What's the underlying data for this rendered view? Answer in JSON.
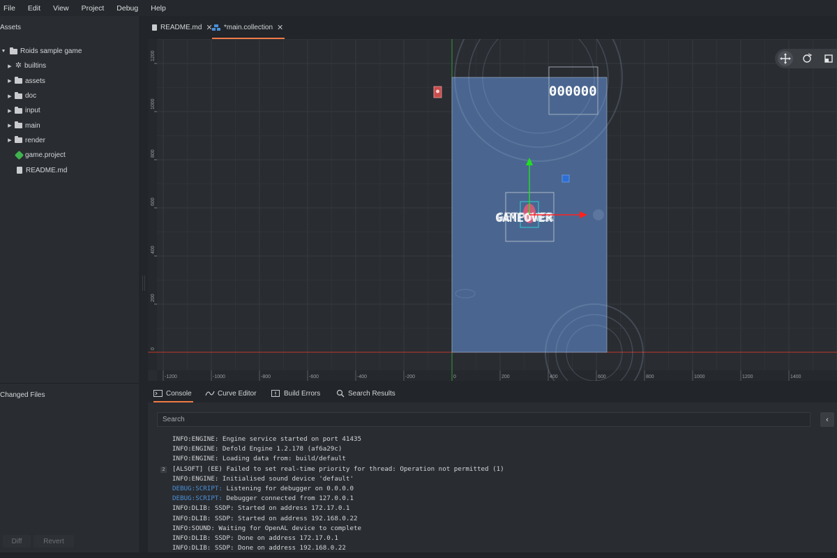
{
  "menu": [
    "File",
    "Edit",
    "View",
    "Project",
    "Debug",
    "Help"
  ],
  "assets_panel": {
    "title": "Assets",
    "tree": [
      {
        "label": "Roids sample game",
        "type": "folder",
        "depth": 0,
        "expanded": true
      },
      {
        "label": "builtins",
        "type": "cog",
        "depth": 1
      },
      {
        "label": "assets",
        "type": "folder",
        "depth": 1
      },
      {
        "label": "doc",
        "type": "folder",
        "depth": 1
      },
      {
        "label": "input",
        "type": "folder",
        "depth": 1
      },
      {
        "label": "main",
        "type": "folder",
        "depth": 1
      },
      {
        "label": "render",
        "type": "folder",
        "depth": 1
      },
      {
        "label": "game.project",
        "type": "project",
        "depth": 1
      },
      {
        "label": "README.md",
        "type": "doc",
        "depth": 1
      }
    ]
  },
  "changed_files": {
    "title": "Changed Files",
    "diff_label": "Diff",
    "revert_label": "Revert"
  },
  "editor_tabs": [
    {
      "label": "README.md",
      "icon": "doc-icon",
      "active": false
    },
    {
      "label": "*main.collection",
      "icon": "collection-icon",
      "active": true
    }
  ],
  "scene": {
    "y_ticks": [
      "1200",
      "1000",
      "800",
      "600",
      "400",
      "200",
      "0"
    ],
    "x_ticks": [
      "-1200",
      "-1000",
      "-800",
      "-600",
      "-400",
      "-200",
      "0",
      "200",
      "400",
      "600",
      "800",
      "1000",
      "1200",
      "1400"
    ],
    "score_text": "000000",
    "overlay_text": "GAMEOVER",
    "overlay_text_2": "GETPOWER",
    "colors": {
      "grid_bg": "#292c31",
      "game_area": "#4a6690",
      "x_axis": "#c0392b",
      "y_axis": "#3a9b3a",
      "gizmo_x": "#ff2020",
      "gizmo_y": "#20e020"
    },
    "toolbar_icons": [
      "move-tool-icon",
      "rotate-tool-icon",
      "scale-tool-icon"
    ]
  },
  "console_tabs": [
    {
      "label": "Console",
      "icon": "terminal-icon",
      "active": true
    },
    {
      "label": "Curve Editor",
      "icon": "curve-icon",
      "active": false
    },
    {
      "label": "Build Errors",
      "icon": "error-icon",
      "active": false
    },
    {
      "label": "Search Results",
      "icon": "search-icon",
      "active": false
    }
  ],
  "console": {
    "search_placeholder": "Search",
    "lines": [
      {
        "tag": "INFO:ENGINE:",
        "text": " Engine service started on port 41435",
        "type": "info"
      },
      {
        "tag": "INFO:ENGINE:",
        "text": " Defold Engine 1.2.178 (af6a29c)",
        "type": "info"
      },
      {
        "tag": "INFO:ENGINE:",
        "text": " Loading data from: build/default",
        "type": "info"
      },
      {
        "tag": "[ALSOFT]",
        "text": " (EE) Failed to set real-time priority for thread: Operation not permitted (1)",
        "type": "info",
        "count": "2"
      },
      {
        "tag": "INFO:ENGINE:",
        "text": " Initialised sound device 'default'",
        "type": "info"
      },
      {
        "tag": "DEBUG:SCRIPT:",
        "text": " Listening for debugger on 0.0.0.0",
        "type": "debug"
      },
      {
        "tag": "DEBUG:SCRIPT:",
        "text": " Debugger connected from 127.0.0.1",
        "type": "debug"
      },
      {
        "tag": "INFO:DLIB:",
        "text": " SSDP: Started on address 172.17.0.1",
        "type": "info"
      },
      {
        "tag": "INFO:DLIB:",
        "text": " SSDP: Started on address 192.168.0.22",
        "type": "info"
      },
      {
        "tag": "INFO:SOUND:",
        "text": " Waiting for OpenAL device to complete",
        "type": "info"
      },
      {
        "tag": "INFO:DLIB:",
        "text": " SSDP: Done on address 172.17.0.1",
        "type": "info"
      },
      {
        "tag": "INFO:DLIB:",
        "text": " SSDP: Done on address 192.168.0.22",
        "type": "info"
      }
    ]
  }
}
